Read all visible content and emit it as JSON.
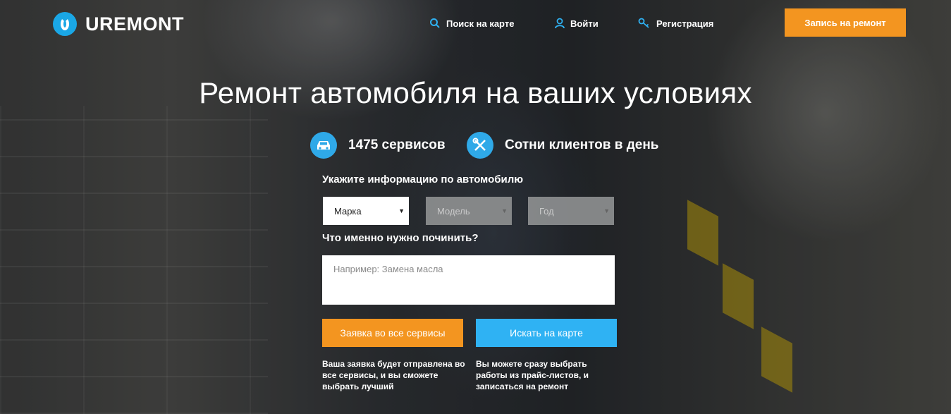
{
  "header": {
    "logo": "UREMONT",
    "nav": {
      "map_search": "Поиск на карте",
      "login": "Войти",
      "register": "Регистрация"
    },
    "cta": "Запись на ремонт"
  },
  "hero": {
    "title": "Ремонт автомобиля на ваших условиях",
    "stats": {
      "services": "1475 сервисов",
      "clients": "Сотни клиентов в день"
    }
  },
  "form": {
    "car_label": "Укажите информацию по автомобилю",
    "make": "Марка",
    "model": "Модель",
    "year": "Год",
    "repair_label": "Что именно нужно починить?",
    "repair_placeholder": "Например: Замена масла",
    "submit_all": "Заявка во все сервисы",
    "search_map": "Искать на карте",
    "note_all": "Ваша заявка будет отправлена во все сервисы, и вы сможете выбрать лучший",
    "note_map": "Вы можете сразу выбрать работы из прайс-листов, и записаться на ремонт"
  },
  "icons": {
    "logo": "wrench-logo-icon",
    "map_search": "search-icon",
    "login": "user-icon",
    "register": "key-icon",
    "services": "car-icon",
    "clients": "tools-icon",
    "dropdown": "caret-down-icon"
  },
  "colors": {
    "accent_orange": "#f39520",
    "accent_blue": "#2fb2f3",
    "icon_blue": "#2fa9e8"
  }
}
